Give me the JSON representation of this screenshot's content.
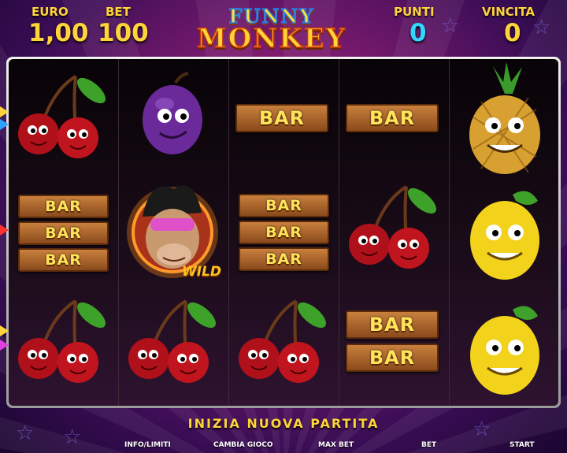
{
  "header": {
    "euro_label": "EURO",
    "euro_value": "1,00",
    "bet_label": "BET",
    "bet_value": "100",
    "punti_label": "PUNTI",
    "punti_value": "0",
    "vincita_label": "VINCITA",
    "vincita_value": "0"
  },
  "logo": {
    "line1": "FUNNY",
    "line2": "MONKEY"
  },
  "reels": {
    "reel1": [
      "cherry",
      "bar-3",
      "cherry"
    ],
    "reel2": [
      "plum",
      "monkey-wild",
      "cherry"
    ],
    "reel3": [
      "bar-1",
      "bar-3",
      "cherry"
    ],
    "reel4": [
      "bar-1",
      "cherry",
      "bar-2"
    ],
    "reel5": [
      "pineapple",
      "lemon",
      "lemon"
    ]
  },
  "symbols": {
    "bar_text": "BAR",
    "wild_text": "WILD"
  },
  "status": {
    "message": "INIZIA  NUOVA  PARTITA"
  },
  "controls": {
    "info": "INFO/LIMITI",
    "cambia": "CAMBIA GIOCO",
    "maxbet": "MAX BET",
    "bet": "BET",
    "start": "START"
  },
  "colors": {
    "accent_gold": "#ffd43a",
    "accent_cyan": "#30d8ff",
    "bar_wood": "#a8602a"
  }
}
